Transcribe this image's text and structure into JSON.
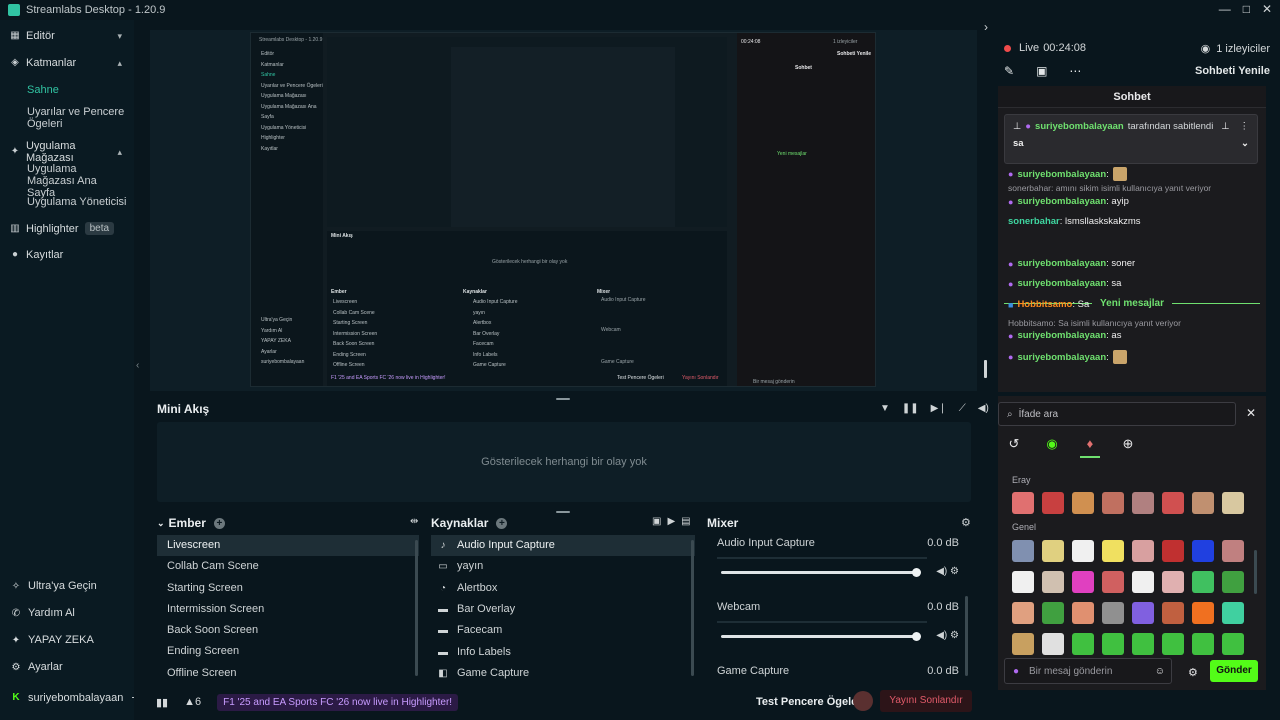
{
  "window": {
    "title": "Streamlabs Desktop - 1.20.9",
    "controls": [
      "—",
      "□",
      "✕"
    ]
  },
  "sidebar": {
    "items": [
      {
        "label": "Editör",
        "icon": "layout-icon"
      },
      {
        "label": "Katmanlar",
        "icon": "layers-icon"
      },
      {
        "label": "Uygulama Mağazası",
        "icon": "store-icon"
      },
      {
        "label": "Highlighter",
        "icon": "highlighter-icon",
        "badge": "beta"
      },
      {
        "label": "Kayıtlar",
        "icon": "recordings-icon"
      }
    ],
    "layer_subitems": [
      "Sahne",
      "Uyarılar ve Pencere Ögeleri"
    ],
    "store_subitems": [
      "Uygulama Mağazası Ana Sayfa",
      "Uygulama Yöneticisi"
    ],
    "bottom": [
      {
        "label": "Ultra'ya Geçin",
        "icon": "ultra-icon"
      },
      {
        "label": "Yardım Al",
        "icon": "help-icon"
      },
      {
        "label": "YAPAY ZEKA",
        "icon": "ai-icon"
      },
      {
        "label": "Ayarlar",
        "icon": "gear-icon"
      },
      {
        "label": "suriyebombalayaan",
        "icon": "kick-icon"
      }
    ]
  },
  "live": {
    "status": "Live",
    "time": "00:24:08",
    "viewers": "1 izleyiciler",
    "refresh": "Sohbeti Yenile"
  },
  "chat": {
    "header": "Sohbet",
    "pinned_user": "suriyebombalayaan",
    "pinned_by": "tarafından sabitlendi",
    "pinned_text": "sa",
    "new_messages": "Yeni mesajlar",
    "messages": [
      {
        "user": "suriyebombalayaan",
        "text": ":"
      },
      {
        "note": "sonerbahar: amını sikim isimli kullanıcıya yanıt veriyor"
      },
      {
        "user": "suriyebombalayaan",
        "text": ": ayip"
      },
      {
        "user": "sonerbahar",
        "text": ": lsmsllaskskakzms"
      },
      {
        "user": "suriyebombalayaan",
        "text": ": soner"
      },
      {
        "user": "suriyebombalayaan",
        "text": ": sa"
      },
      {
        "user": "Hobbitsamo",
        "text": ": Sa"
      },
      {
        "note": "Hobbitsamo: Sa isimli kullanıcıya yanıt veriyor"
      },
      {
        "user": "suriyebombalayaan",
        "text": ": as"
      },
      {
        "user": "suriyebombalayaan",
        "text": ":"
      }
    ]
  },
  "emotes": {
    "search_placeholder": "İfade ara",
    "section_1": "Eray",
    "section_2": "Genel",
    "input_placeholder": "Bir mesaj gönderin",
    "send": "Gönder",
    "colors_row1": [
      "#e07070",
      "#c84040",
      "#d09050",
      "#c07060",
      "#b08080",
      "#d05050",
      "#c09070",
      "#d8c8a0"
    ],
    "colors_row2": [
      "#8090b0",
      "#e0d080",
      "#f0f0f0",
      "#f0e060",
      "#d8a0a0",
      "#c03030",
      "#2040e0",
      "#c08080"
    ],
    "colors_row3": [
      "#f0f0f0",
      "#d0c0b0",
      "#e040c0",
      "#d06060",
      "#f0f0f0",
      "#e0b0b0",
      "#40c060",
      "#40a040"
    ],
    "colors_row4": [
      "#e0a080",
      "#40a040",
      "#e09070",
      "#909090",
      "#8060e0",
      "#c06040",
      "#f07020",
      "#40d0a0"
    ],
    "colors_row5": [
      "#c8a060",
      "#e0e0e0",
      "#40c040",
      "#40c040",
      "#40c040",
      "#40c040",
      "#40c040",
      "#40c040"
    ]
  },
  "mini_feed": {
    "title": "Mini Akış",
    "empty": "Gösterilecek herhangi bir olay yok"
  },
  "scenes": {
    "title": "Ember",
    "items": [
      "Livescreen",
      "Collab Cam Scene",
      "Starting Screen",
      "Intermission Screen",
      "Back Soon Screen",
      "Ending Screen",
      "Offline Screen"
    ]
  },
  "sources": {
    "title": "Kaynaklar",
    "items": [
      {
        "label": "Audio Input Capture",
        "icon": "mic-icon"
      },
      {
        "label": "yayın",
        "icon": "monitor-icon"
      },
      {
        "label": "Alertbox",
        "icon": "alert-icon"
      },
      {
        "label": "Bar Overlay",
        "icon": "folder-icon"
      },
      {
        "label": "Facecam",
        "icon": "folder-icon"
      },
      {
        "label": "Info Labels",
        "icon": "folder-icon"
      },
      {
        "label": "Game Capture",
        "icon": "game-icon"
      }
    ]
  },
  "mixer": {
    "title": "Mixer",
    "channels": [
      {
        "name": "Audio Input Capture",
        "db": "0.0 dB",
        "level": 1.0
      },
      {
        "name": "Webcam",
        "db": "0.0 dB",
        "level": 1.0
      },
      {
        "name": "Game Capture",
        "db": "0.0 dB",
        "level": 1.0
      }
    ]
  },
  "footer": {
    "notifications": "6",
    "promo": "F1 '25 and EA Sports FC '26 now live in Highlighter!",
    "test_items": "Test Pencere Ögeleri",
    "end_stream": "Yayını Sonlandır"
  },
  "preview": {
    "mini_title": "Streamlabs Desktop - 1.20.9",
    "mini_feed": "Mini Akış",
    "mini_empty": "Gösterilecek herhangi bir olay yok",
    "mini_scenes": "Ember",
    "mini_sources": "Kaynaklar",
    "mini_mixer": "Mixer"
  }
}
